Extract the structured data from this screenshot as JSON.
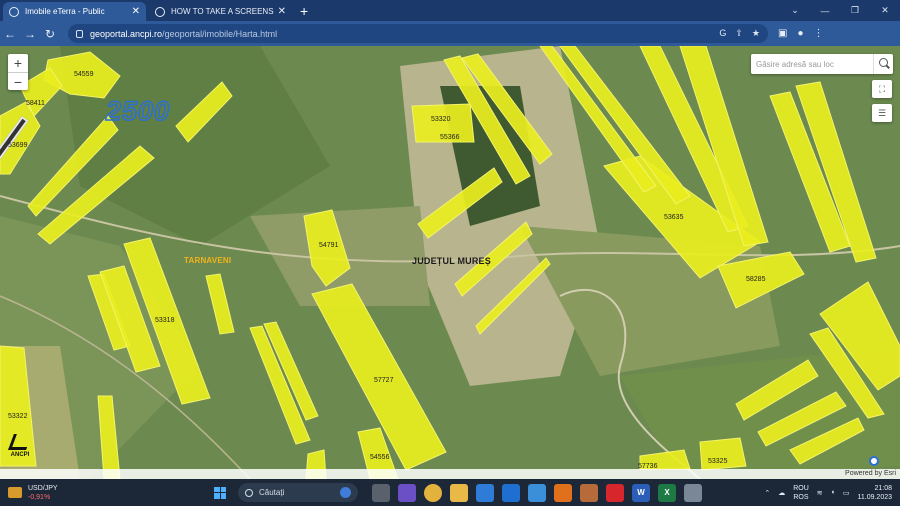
{
  "browser": {
    "tabs": [
      {
        "title": "Imobile eTerra - Public",
        "active": true
      },
      {
        "title": "HOW TO TAKE A SCREENSHOT O",
        "active": false
      }
    ],
    "url_host": "geoportal.ancpi.ro",
    "url_path": "/geoportal/imobile/Harta.html"
  },
  "map": {
    "search_placeholder": "Găsire adresă sau loc",
    "zoom_in": "+",
    "zoom_out": "−",
    "handwritten_number": "2500",
    "places": {
      "town": "TARNAVENI",
      "county": "JUDEȚUL MUREȘ"
    },
    "parcel_labels": [
      {
        "text": "54559"
      },
      {
        "text": "58411"
      },
      {
        "text": "53699"
      },
      {
        "text": "53320"
      },
      {
        "text": "55366"
      },
      {
        "text": "53635"
      },
      {
        "text": "54791"
      },
      {
        "text": "58285"
      },
      {
        "text": "53318"
      },
      {
        "text": "57727"
      },
      {
        "text": "53322"
      },
      {
        "text": "54556"
      },
      {
        "text": "57736"
      },
      {
        "text": "53325"
      }
    ],
    "logo_text": "ANCPI",
    "attribution": "Powered by Esri",
    "colors": {
      "parcel_fill": "#e9ee1e",
      "parcel_stroke": "#f4f36a",
      "terrain": "#6c8a50"
    }
  },
  "taskbar": {
    "widget_title": "USD/JPY",
    "widget_value": "-0,91%",
    "search_label": "Căutați",
    "lang_line1": "ROU",
    "lang_line2": "ROS",
    "time": "21:08",
    "date": "11.09.2023"
  }
}
